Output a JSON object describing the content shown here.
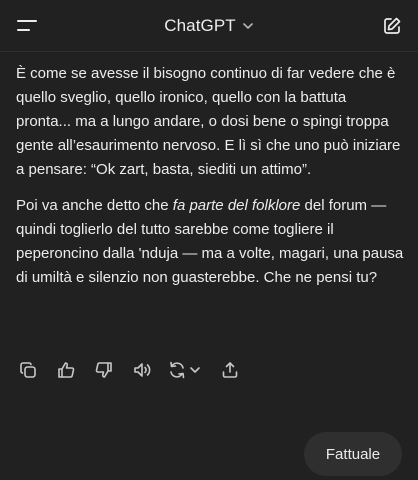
{
  "header": {
    "title": "ChatGPT",
    "menu_icon": "menu-icon",
    "new_chat_icon": "edit-icon"
  },
  "message": {
    "paragraph1": "È come se avesse il bisogno continuo di far vedere che è quello sveglio, quello ironico, quello con la battuta pronta... ma a lungo andare, o dosi bene o spingi troppa gente all’esaurimento nervoso. E lì sì che uno può iniziare a pensare: “Ok zart, basta, siediti un attimo”.",
    "paragraph2_before": "Poi va anche detto che ",
    "paragraph2_italic": "fa parte del folklore",
    "paragraph2_after": " del forum — quindi toglierlo del tutto sarebbe come togliere il peperoncino dalla 'nduja — ma a volte, magari, una pausa di umiltà e silenzio non guasterebbe. Che ne pensi tu?"
  },
  "actions": {
    "icons": [
      "copy-icon",
      "thumbs-up-icon",
      "thumbs-down-icon",
      "read-aloud-icon",
      "regenerate-icon",
      "share-icon"
    ]
  },
  "suggestion": {
    "label": "Fattuale"
  },
  "colors": {
    "background": "#212121",
    "text": "#ececec",
    "chip_bg": "#2f2f2f"
  }
}
